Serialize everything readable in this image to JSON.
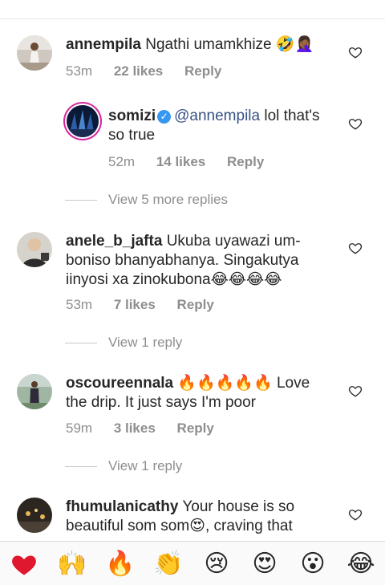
{
  "comments": [
    {
      "username": "annempila",
      "text": "Ngathi umamkhize 🤣🤦🏾‍♀️",
      "time": "53m",
      "likes": "22 likes",
      "reply_label": "Reply"
    },
    {
      "username": "somizi",
      "mention": "@annempila",
      "text": " lol that's so true",
      "time": "52m",
      "likes": "14 likes",
      "reply_label": "Reply"
    },
    {
      "view_replies": "View 5 more replies"
    },
    {
      "username": "anele_b_jafta",
      "text": "Ukuba uyawazi um- boniso bhanyabhanya. Singakutya iinyosi xa zinokubona😂😂😂😂",
      "time": "53m",
      "likes": "7 likes",
      "reply_label": "Reply",
      "view_replies": "View 1 reply"
    },
    {
      "username": "oscoureennala",
      "text": "🔥🔥🔥🔥🔥 Love the drip. It just says I'm poor",
      "time": "59m",
      "likes": "3 likes",
      "reply_label": "Reply",
      "view_replies": "View 1 reply"
    },
    {
      "username": "fhumulanicathy",
      "text": "Your house is so beautiful som som😍, craving that"
    }
  ],
  "emoji_bar": {
    "items": [
      {
        "name": "red-heart",
        "glyph": "❤"
      },
      {
        "name": "raising-hands",
        "glyph": "🙌"
      },
      {
        "name": "fire",
        "glyph": "🔥"
      },
      {
        "name": "clapping-hands",
        "glyph": "👏"
      },
      {
        "name": "crying-face",
        "glyph": "😢"
      },
      {
        "name": "heart-eyes",
        "glyph": "😍"
      },
      {
        "name": "astonished-face",
        "glyph": "😮"
      },
      {
        "name": "tears-of-joy",
        "glyph": "😂"
      }
    ]
  },
  "colors": {
    "text": "#262626",
    "muted": "#8e8e8e",
    "mention": "#385185",
    "verified": "#3897f0"
  }
}
